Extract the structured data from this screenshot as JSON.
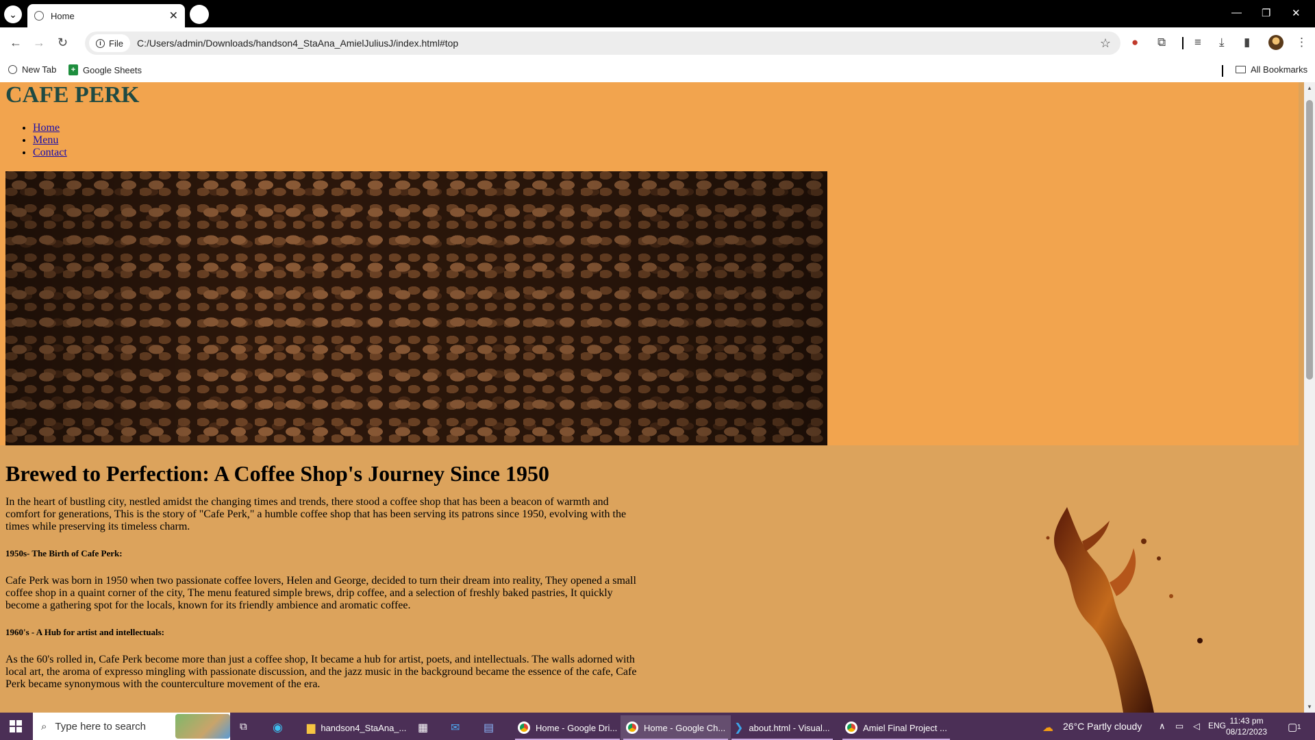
{
  "browser": {
    "tab_title": "Home",
    "url_chip": "File",
    "url": "C:/Users/admin/Downloads/handson4_StaAna_AmielJuliusJ/index.html#top",
    "bookmarks": [
      {
        "label": "New Tab",
        "icon": "globe-icon"
      },
      {
        "label": "Google Sheets",
        "icon": "google-sheets-icon"
      }
    ],
    "all_bookmarks": "All Bookmarks"
  },
  "page": {
    "site_title": "CAFE PERK",
    "nav": [
      "Home",
      "Menu",
      "Contact"
    ],
    "heading": "Brewed to Perfection: A Coffee Shop's Journey Since 1950",
    "intro": "In the heart of bustling city, nestled amidst the changing times and trends, there stood a coffee shop that has been a beacon of warmth and comfort for generations, This is the story of \"Cafe Perk,\" a humble coffee shop that has been serving its patrons since 1950, evolving with the times while preserving its timeless charm.",
    "sections": [
      {
        "title": "1950s- The Birth of Cafe Perk:",
        "body": "Cafe Perk was born in 1950 when two passionate coffee lovers, Helen and George, decided to turn their dream into reality, They opened a small coffee shop in a quaint corner of the city, The menu featured simple brews, drip coffee, and a selection of freshly baked pastries, It quickly become a gathering spot for the locals, known for its friendly ambience and aromatic coffee."
      },
      {
        "title": "1960's - A Hub for artist and intellectuals:",
        "body": "As the 60's rolled in, Cafe Perk become more than just a coffee shop, It became a hub for artist, poets, and intellectuals. The walls adorned with local art, the aroma of expresso mingling with passionate discussion, and the jazz music in the background became the essence of the cafe, Cafe Perk became synonymous with the counterculture movement of the era."
      }
    ],
    "colors": {
      "header_bg": "#f2a44e",
      "body_bg": "#dca35c",
      "title_color": "#1f4a43"
    }
  },
  "taskbar": {
    "search_placeholder": "Type here to search",
    "apps": [
      {
        "label": "handson4_StaAna_...",
        "icon": "folder-icon"
      },
      {
        "label": "Home - Google Dri...",
        "icon": "chrome-icon"
      },
      {
        "label": "Home - Google Ch...",
        "icon": "chrome-icon",
        "active": true
      },
      {
        "label": "about.html - Visual...",
        "icon": "vscode-icon"
      },
      {
        "label": "Amiel Final Project ...",
        "icon": "chrome-icon"
      }
    ],
    "weather": "26°C  Partly cloudy",
    "language": "ENG",
    "time": "11:43 pm",
    "date": "08/12/2023",
    "notification_count": "1"
  }
}
